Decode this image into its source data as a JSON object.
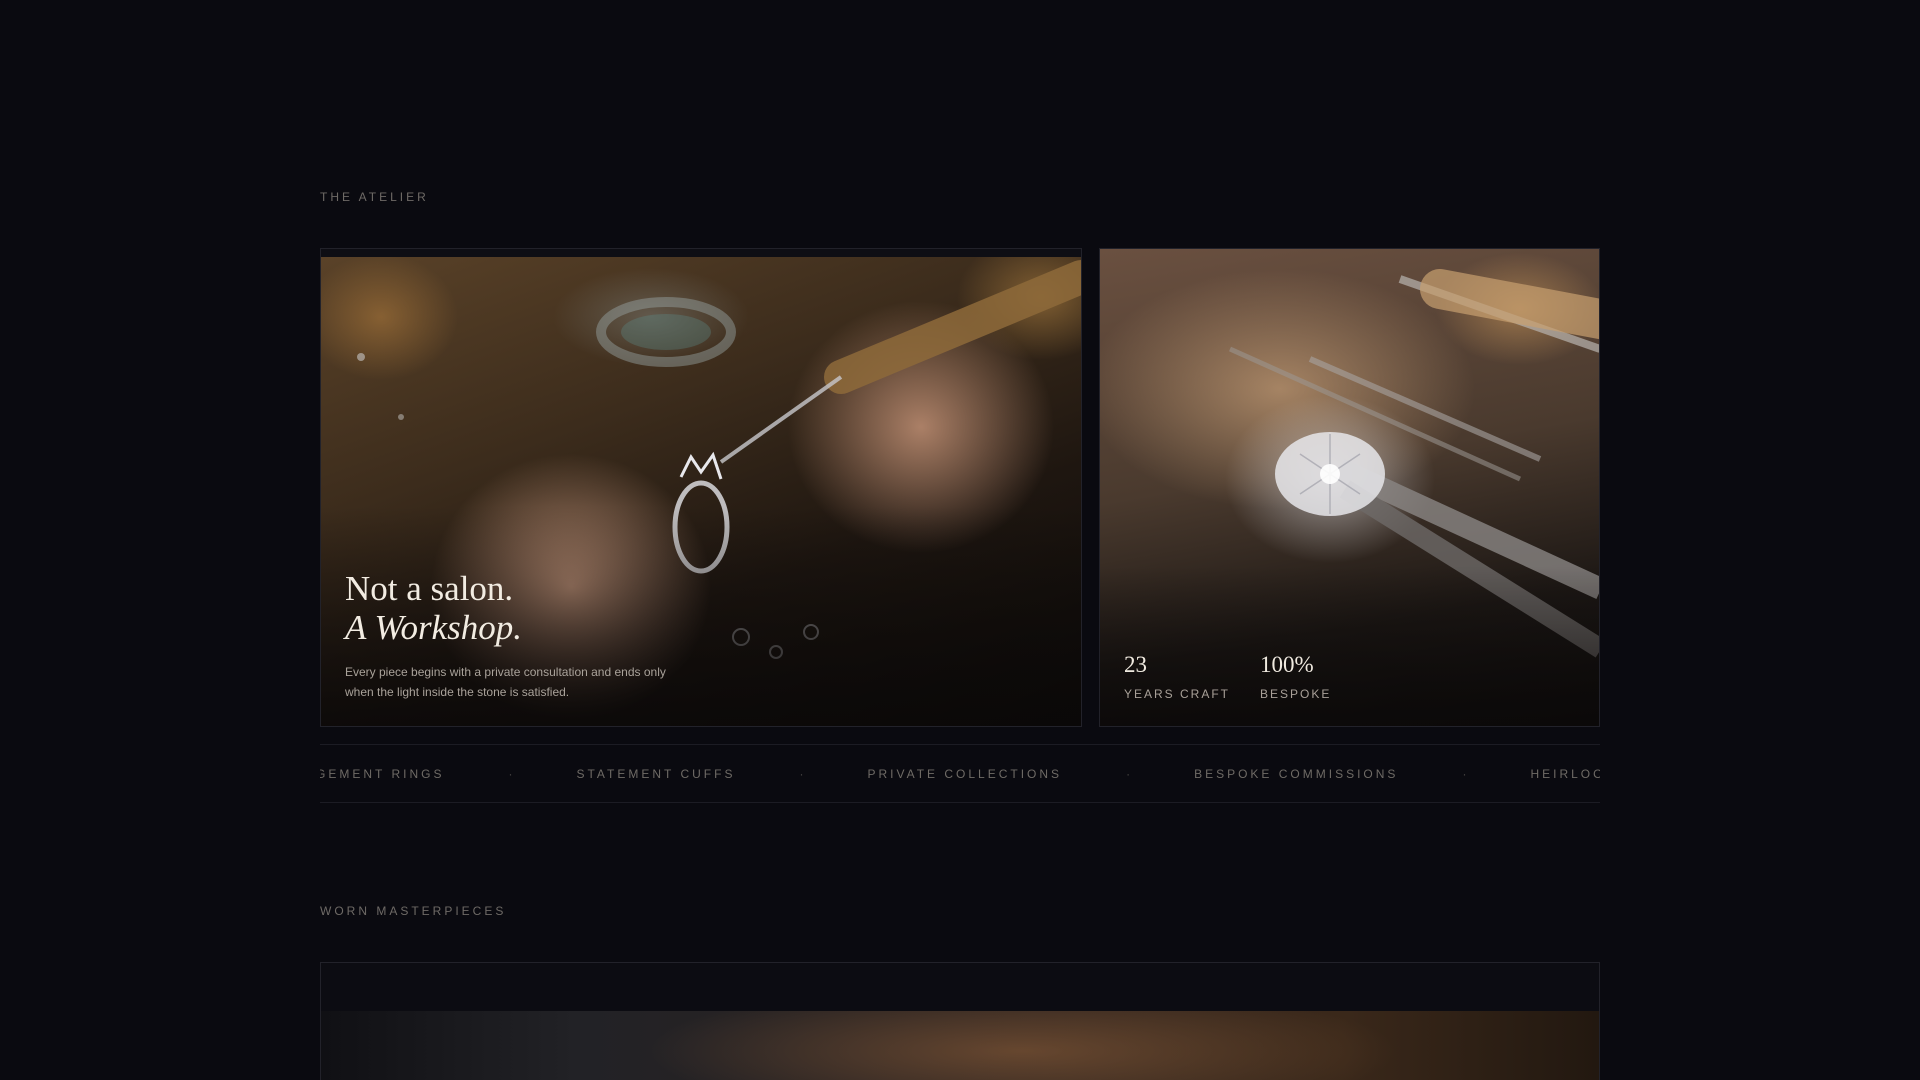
{
  "atelier": {
    "label": "THE ATELIER",
    "workshop_card": {
      "headline_line1": "Not a salon.",
      "headline_line2": "A Workshop.",
      "description": "Every piece begins with a private consultation and ends only when the light inside the stone is satisfied."
    },
    "stats": [
      {
        "value": "23",
        "label": "YEARS CRAFT"
      },
      {
        "value": "100%",
        "label": "BESPOKE"
      }
    ]
  },
  "marquee": {
    "items": [
      "ENGAGEMENT RINGS",
      "STATEMENT CUFFS",
      "PRIVATE COLLECTIONS",
      "BESPOKE COMMISSIONS",
      "HEIRLOOM"
    ],
    "separator": "·"
  },
  "worn": {
    "label": "WORN MASTERPIECES"
  }
}
